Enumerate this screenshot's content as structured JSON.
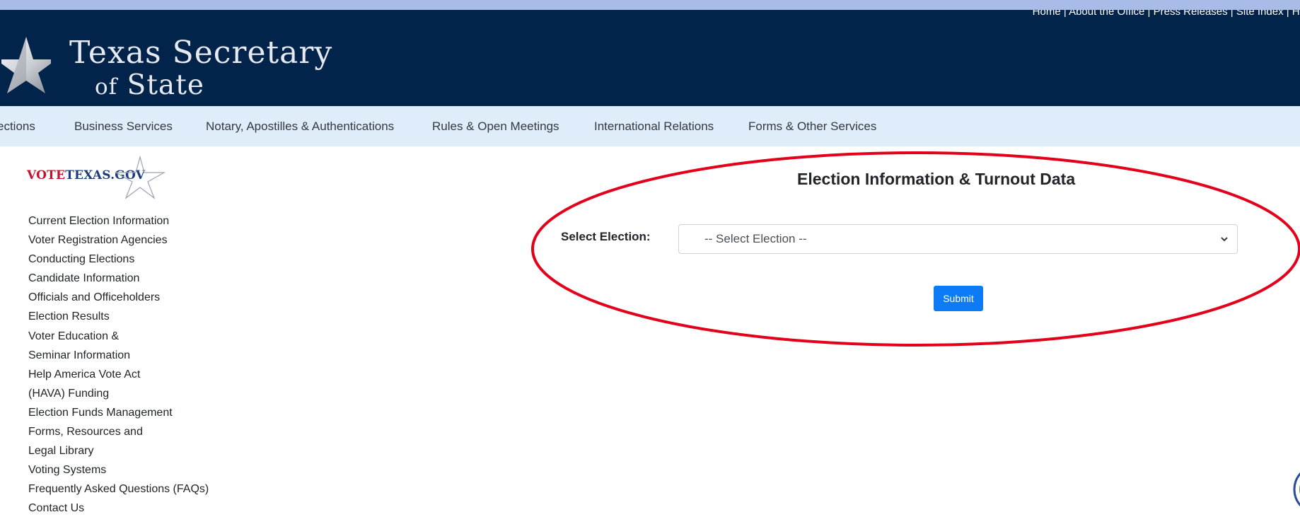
{
  "header": {
    "top_links": "Home | About the Office | Press Releases | Site Index | He",
    "logo_line1": "Texas Secretary",
    "logo_line2_of": "of",
    "logo_line2_state": "State"
  },
  "nav": {
    "items": [
      "ections",
      "Business Services",
      "Notary, Apostilles & Authentications",
      "Rules & Open Meetings",
      "International Relations",
      "Forms & Other Services"
    ]
  },
  "sidebar": {
    "logo_vote": "VOTE",
    "logo_rest": "TEXAS.GOV",
    "links": [
      "Current Election Information",
      "Voter Registration Agencies",
      "Conducting Elections",
      "Candidate Information",
      "Officials and Officeholders",
      "Election Results",
      "Voter Education &",
      "Seminar Information",
      "Help America Vote Act",
      "(HAVA) Funding",
      "Election Funds Management",
      "Forms, Resources and",
      "Legal Library",
      "Voting Systems",
      "Frequently Asked Questions (FAQs)",
      "Contact Us"
    ]
  },
  "main": {
    "title": "Election Information & Turnout Data",
    "select_label": "Select Election:",
    "select_value": "-- Select Election --",
    "submit_label": "Submit"
  },
  "colors": {
    "header_bg": "#02244a",
    "nav_bg": "#dfecfa",
    "button_blue": "#0d7bf5",
    "annotation_red": "#e3001b",
    "outer_border": "#a9bce8"
  }
}
